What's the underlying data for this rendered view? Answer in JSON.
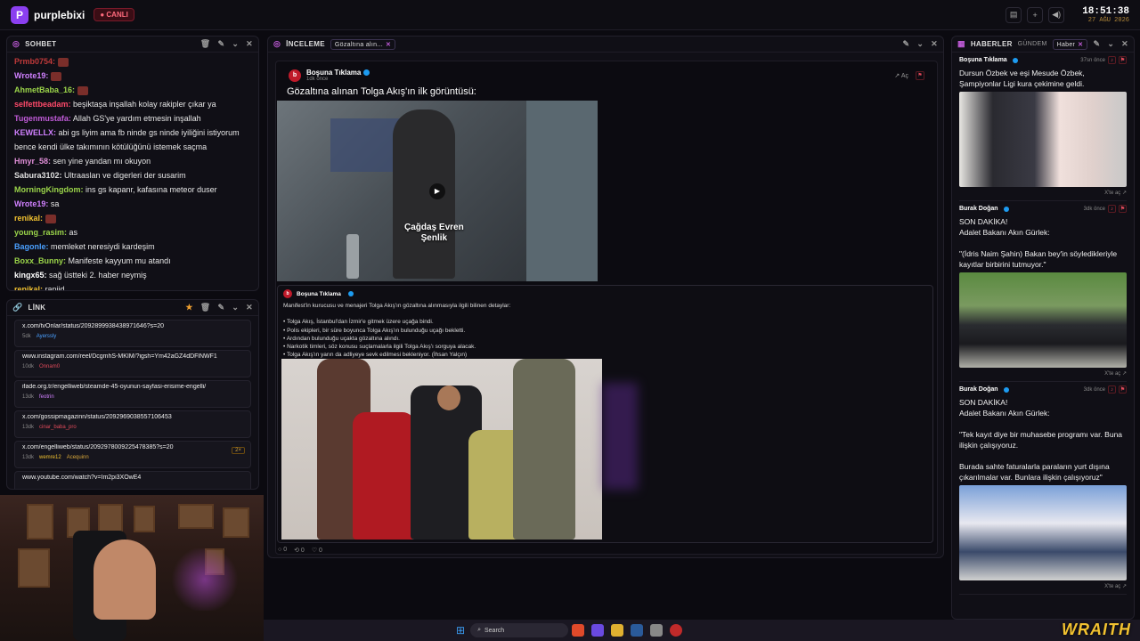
{
  "app": {
    "brand": "purplebixi",
    "live_label": "● CANLI",
    "time": "18:51:38",
    "date": "27 AĞU 2026"
  },
  "chat": {
    "title": "SOHBET",
    "messages": [
      {
        "user": "Prmb0754:",
        "text": "",
        "color": "#c03a3a"
      },
      {
        "user": "Wrote19:",
        "text": "",
        "color": "#d080ff"
      },
      {
        "user": "AhmetBaba_16:",
        "text": "",
        "color": "#9bd54a"
      },
      {
        "user": "selfettbeadam:",
        "text": "beşiktaşa inşallah kolay rakipler çıkar ya",
        "color": "#ff4a6a"
      },
      {
        "user": "Tugenmustafa:",
        "text": "Allah GS'ye yardım etmesin inşallah",
        "color": "#c05bd8"
      },
      {
        "user": "KEWELLX:",
        "text": "abi gs liyim ama fb ninde gs ninde iyiliğini istiyorum",
        "color": "#d080ff"
      },
      {
        "user": "",
        "text": "bence kendi ülke takımının kötülüğünü istemek saçma",
        "color": "#fff"
      },
      {
        "user": "Hmyr_58:",
        "text": "sen yine yandan mı okuyon",
        "color": "#e08fd8"
      },
      {
        "user": "Sabura3102:",
        "text": "Ultraaslan ve digerleri der susarim",
        "color": "#e0e0e0"
      },
      {
        "user": "MorningKingdom:",
        "text": "ins gs kapanr, kafasına meteor duser",
        "color": "#9bd54a"
      },
      {
        "user": "Wrote19:",
        "text": "sa",
        "color": "#d080ff"
      },
      {
        "user": "renikal:",
        "text": "",
        "color": "#f2c230"
      },
      {
        "user": "young_rasim:",
        "text": "as",
        "color": "#9bd54a"
      },
      {
        "user": "Bagonle:",
        "text": "memleket neresiydi kardeşim",
        "color": "#4aa0ff"
      },
      {
        "user": "Boxx_Bunny:",
        "text": "Manifeste kayyum mu atandı",
        "color": "#9bd54a"
      },
      {
        "user": "kingx65:",
        "text": "sağ üstteki 2. haber neymiş",
        "color": "#ffffff"
      },
      {
        "user": "renikal:",
        "text": "ranjid",
        "color": "#f2c230"
      }
    ]
  },
  "links": {
    "title": "LİNK",
    "items": [
      {
        "url": "x.com/tvOnlar/status/2092899938438971646?s=20",
        "age": "5dk",
        "user": "Ayerssly",
        "ucolor": "#4aa0ff"
      },
      {
        "url": "www.instagram.com/reel/DcgmhS-MKIM/?igsh=Ym42aGZ4dDFlNWF1",
        "age": "10dk",
        "user": "Onnam0",
        "ucolor": "#e04a5a"
      },
      {
        "url": "ifade.org.tr/engelliweb/steamde-45-oyunun-sayfasi-erisime-engelli/",
        "age": "13dk",
        "user": "feotrin",
        "ucolor": "#d080ff"
      },
      {
        "url": "x.com/gossipmagazinn/status/2092969038557106453",
        "age": "13dk",
        "user": "cinar_baba_pro",
        "ucolor": "#e04a5a"
      },
      {
        "url": "x.com/engelliweb/status/2092978009225478385?s=20",
        "age": "13dk",
        "user": "wemre12",
        "ucolor": "#f2c230",
        "extra": "Acequinn",
        "badge": "2×"
      },
      {
        "url": "www.youtube.com/watch?v=Im2pi3XOwE4",
        "age": "",
        "user": "",
        "ucolor": "#888"
      }
    ]
  },
  "preview": {
    "title": "İNCELEME",
    "tag": "Gözaltına alın...",
    "author": "Boşuna Tıklama",
    "time": "1dk önce",
    "open": "Aç",
    "headline": "Gözaltına alınan Tolga Akış'ın ilk görüntüsü:",
    "video_caption_1": "Çağdaş Evren",
    "video_caption_2": "Şenlik",
    "quote_author": "Boşuna Tıklama",
    "quote_lines": [
      "Manifest'in kurucusu ve menajeri Tolga Akış'ın gözaltına alınmasıyla ilgili bilinen detaylar:",
      "",
      "• Tolga Akış, İstanbul'dan İzmir'e gitmek üzere uçağa bindi.",
      "• Polis ekipleri, bir süre boyunca Tolga Akış'ın bulunduğu uçağı bekletti.",
      "• Ardından bulunduğu uçakta gözaltına alındı.",
      "• Narkotik timleri, söz konusu suçlamalarla ilgili Tolga Akış'ı sorguya alacak.",
      "• Tolga Akış'ın yarın da adliyeye sevk edilmesi bekleniyor. (İhsan Yalçın)"
    ],
    "stats": {
      "replies": "0",
      "reposts": "0",
      "likes": "0"
    }
  },
  "news": {
    "title": "HABERLER",
    "tab": "GÜNDEM",
    "tag": "Haber",
    "open_label": "X'te aç ↗",
    "items": [
      {
        "author": "Boşuna Tıklama",
        "time": "37sn önce",
        "text": "Dursun Özbek ve eşi Mesude Özbek, Şampiyonlar Ligi kura çekimine geldi."
      },
      {
        "author": "Burak Doğan",
        "time": "3dk önce",
        "text": "SON DAKİKA!\nAdalet Bakanı Akın Gürlek:\n\n\"(İdris Naim Şahin) Bakan bey'in söyledikleriyle kayıtlar birbirini tutmuyor.\""
      },
      {
        "author": "Burak Doğan",
        "time": "3dk önce",
        "text": "SON DAKİKA!\nAdalet Bakanı Akın Gürlek:\n\n\"Tek kayıt diye bir muhasebe programı var. Buna ilişkin çalışıyoruz.\n\nBurada sahte faturalarla paraların yurt dışına çıkarılmalar var. Bunlara ilişkin çalışıyoruz\""
      }
    ]
  },
  "taskbar": {
    "search": "Search"
  },
  "overlay": {
    "brand": "WRAITH"
  }
}
